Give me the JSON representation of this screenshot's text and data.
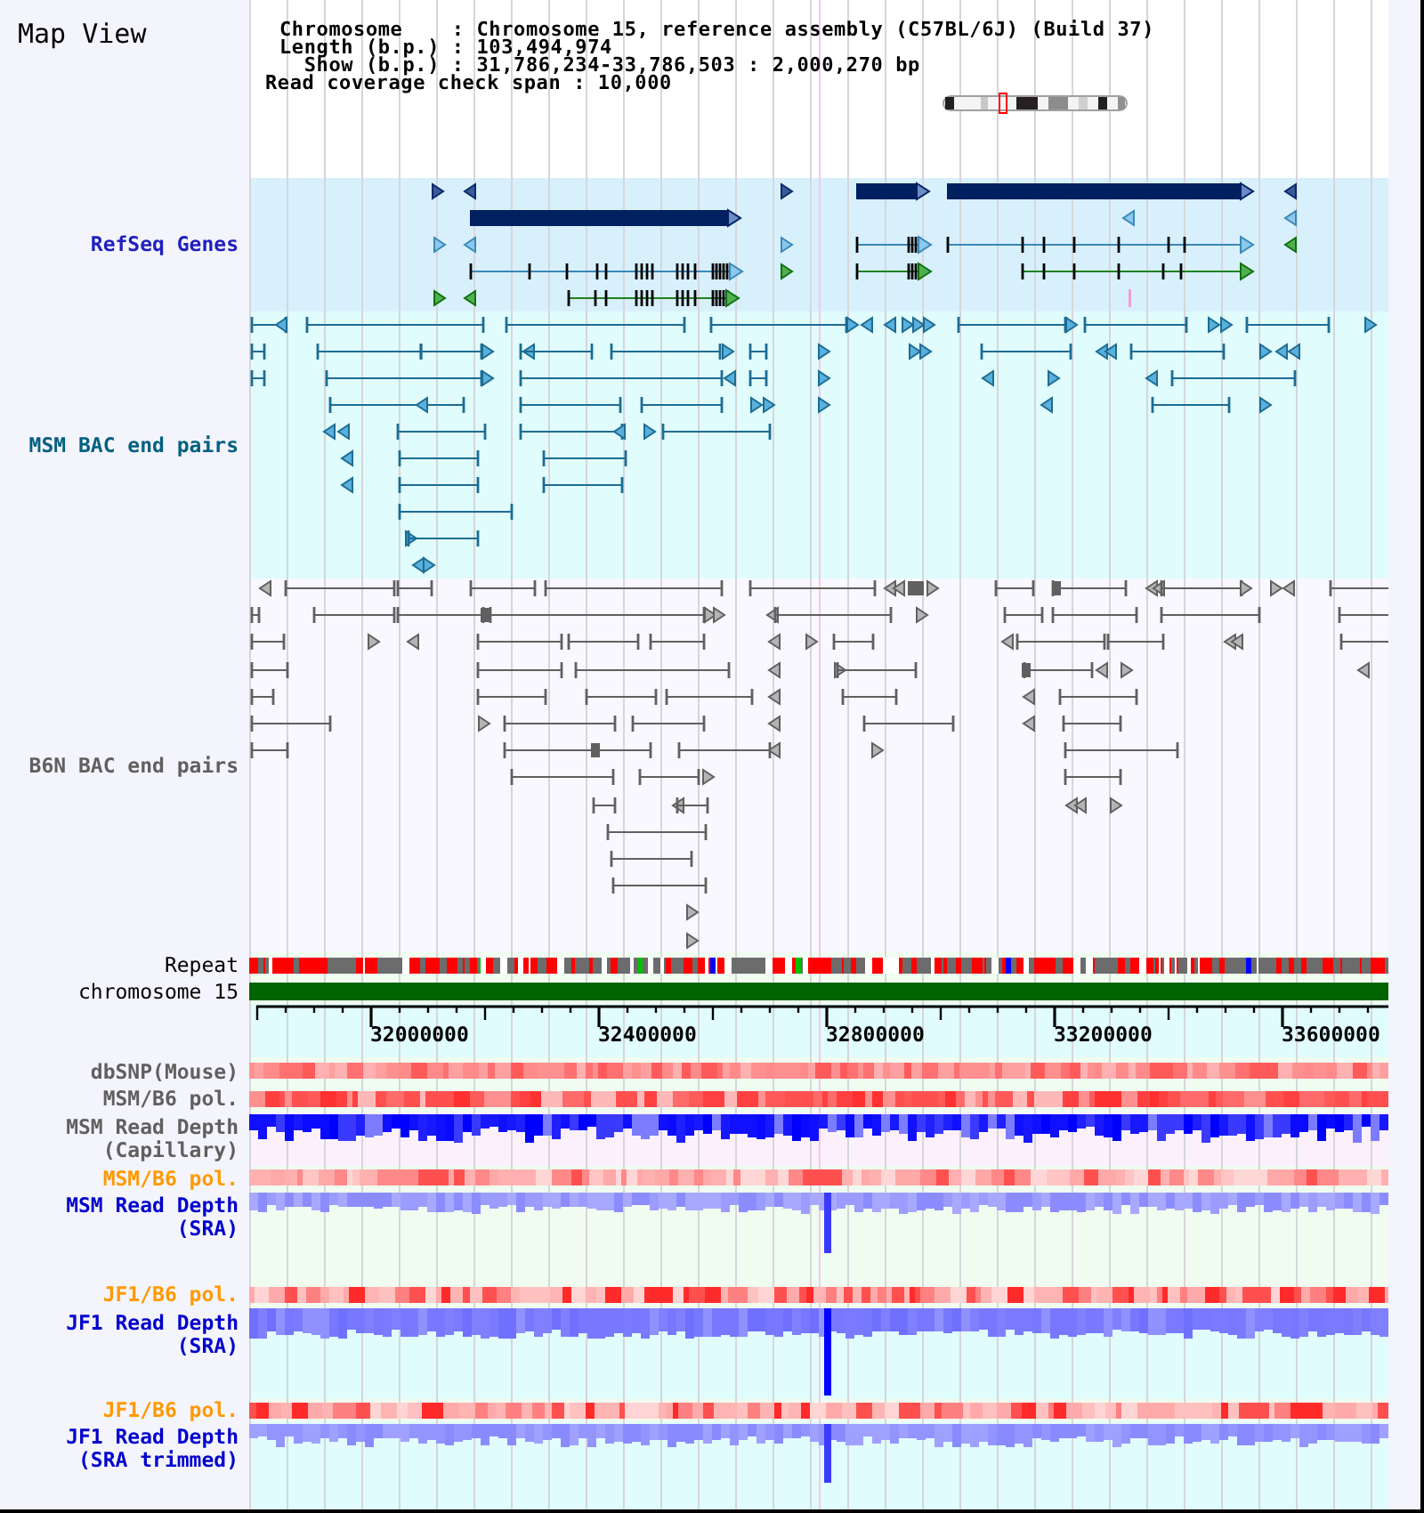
{
  "title": "Map View",
  "summary": [
    "Chromosome    : Chromosome 15, reference assembly (C57BL/6J) (Build 37)",
    "Length (b.p.) : 103,494,974",
    "  Show (b.p.) : 31,786,234-33,786,503 : 2,000,270 bp",
    "Read coverage check span : 10,000"
  ],
  "tracks": [
    {
      "kind": "genes",
      "label": "RefSeq Genes",
      "color": "#2020c0"
    },
    {
      "kind": "bac_pairs",
      "label": "MSM BAC end pairs",
      "color": "#006080"
    },
    {
      "kind": "bac_pairs",
      "label": "B6N BAC end pairs",
      "color": "#606060"
    },
    {
      "kind": "repeat",
      "label": "Repeat",
      "color": "#000000"
    },
    {
      "kind": "chromosome",
      "label": "chromosome 15",
      "color": "#000000"
    },
    {
      "kind": "ruler",
      "ticks": [
        "32000000",
        "32400000",
        "32800000",
        "33200000",
        "33600000"
      ]
    },
    {
      "kind": "heatmap",
      "label": "dbSNP(Mouse)",
      "color": "#606060"
    },
    {
      "kind": "heatmap",
      "label": "MSM/B6 pol.",
      "color": "#606060"
    },
    {
      "kind": "depth",
      "label": "MSM Read Depth (Capillary)",
      "color": "#606060"
    },
    {
      "kind": "heatmap",
      "label": "MSM/B6 pol.",
      "color": "#ff9900"
    },
    {
      "kind": "depth",
      "label": "MSM Read Depth (SRA)",
      "color": "#0000cc"
    },
    {
      "kind": "heatmap",
      "label": "JF1/B6 pol.",
      "color": "#ff9900"
    },
    {
      "kind": "depth",
      "label": "JF1 Read Depth (SRA)",
      "color": "#0000cc"
    },
    {
      "kind": "heatmap",
      "label": "JF1/B6 pol.",
      "color": "#ff9900"
    },
    {
      "kind": "depth",
      "label": "JF1 Read Depth (SRA trimmed)",
      "color": "#0000cc"
    }
  ]
}
